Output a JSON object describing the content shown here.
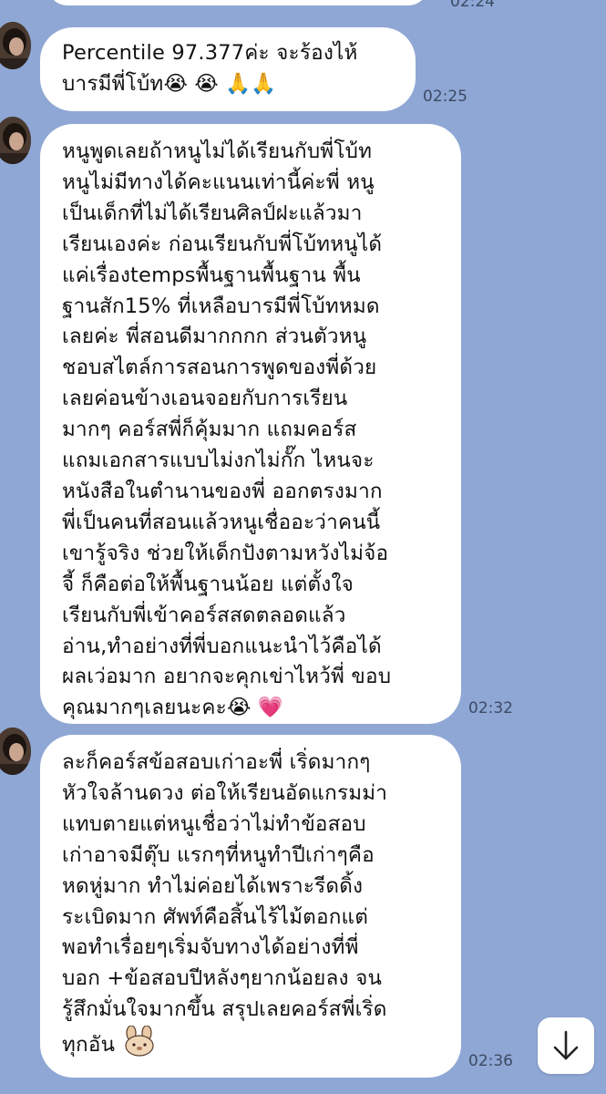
{
  "messages": [
    {
      "lines": [
        "Percentile 97.377ค่ะ จะร้องไห้",
        "บารมีพี่โบ้ท😭 😭 🙏🙏"
      ],
      "time": "02:25"
    },
    {
      "lines": [
        "หนูพูดเลยถ้าหนูไม่ได้เรียนกับพี่โบ้ท",
        "หนูไม่มีทางได้คะแนนเท่านี้ค่ะพี่ หนู",
        "เป็นเด็กที่ไม่ได้เรียนศิลป์ฝะแล้วมา",
        "เรียนเองค่ะ ก่อนเรียนกับพี่โบ้ทหนูได้",
        "แค่เรื่องtempsพื้นฐานพื้นฐาน พื้น",
        "ฐานสัก15% ที่เหลือบารมีพี่โบ้ทหมด",
        "เลยค่ะ พี่สอนดีมากกกก ส่วนตัวหนู",
        "ชอบสไตล์การสอนการพูดของพี่ด้วย",
        "เลยค่อนข้างเอนจอยกับการเรียน",
        "มากๆ คอร์สพี่ก็คุ้มมาก แถมคอร์ส",
        "แถมเอกสารแบบไม่งกไม่กั๊ก ไหนจะ",
        "หนังสือในตำนานของพี่ ออกตรงมาก",
        "พี่เป็นคนที่สอนแล้วหนูเชื่ออะว่าคนนี้",
        "เขารู้จริง ช่วยให้เด็กปังตามหวังไม่จ้อ",
        "จี้ ก็คือต่อให้พื้นฐานน้อย แต่ตั้งใจ",
        "เรียนกับพี่เข้าคอร์สสดตลอดแล้ว",
        "อ่าน,ทำอย่างที่พี่บอกแนะนำไว้คือได้",
        "ผลเว่อมาก อยากจะคุกเข่าไหว้พี่ ขอบ",
        "คุณมากๆเลยนะคะ😭 💗"
      ],
      "time": "02:32"
    },
    {
      "lines": [
        "ละก็คอร์สข้อสอบเก่าอะพี่ เริ่ดมากๆ",
        "หัวใจล้านดวง ต่อให้เรียนอัดแกรมม่า",
        "แทบตายแต่หนูเชื่อว่าไม่ทำข้อสอบ",
        "เก่าอาจมีตุ๊บ แรกๆที่หนูทำปีเก่าๆคือ",
        "หดหู่มาก ทำไม่ค่อยได้เพราะรีดดิ้ง",
        "ระเบิดมาก ศัพท์คือสิ้นไร้ไม้ตอกแต่",
        "พอทำเรื่อยๆเริ่มจับทางได้อย่างที่พี่",
        "บอก +ข้อสอบปีหลังๆยากน้อยลง จน",
        "รู้สึกมั่นใจมากขึ้น สรุปเลยคอร์สพี่เริ่ด",
        "ทุกอัน"
      ],
      "time": "02:36"
    }
  ],
  "top_time": "02:24",
  "icons": {
    "sticker": "bunny-sticker-icon",
    "scroll": "arrow-down-icon"
  },
  "colors": {
    "background": "#8fa7d4",
    "bubble": "#ffffff",
    "time": "#3c4a66"
  }
}
